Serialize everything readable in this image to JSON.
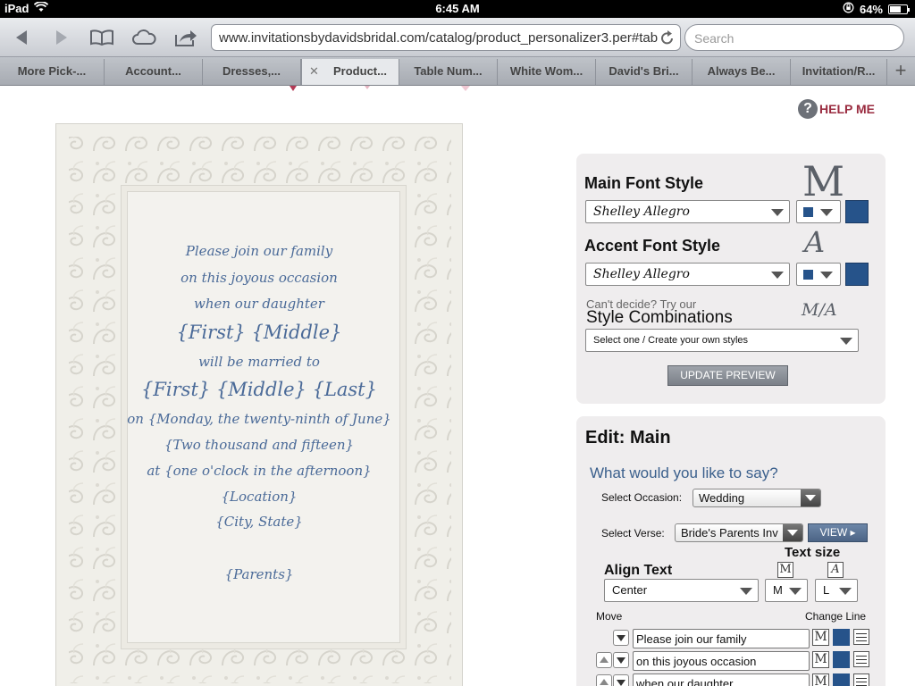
{
  "status_bar": {
    "device": "iPad",
    "time": "6:45 AM",
    "battery": "64%",
    "battery_level": 0.64
  },
  "toolbar": {
    "url": "www.invitationsbydavidsbridal.com/catalog/product_personalizer3.per#tab",
    "search_placeholder": "Search"
  },
  "tabs": [
    {
      "label": "More Pick-..."
    },
    {
      "label": "Account..."
    },
    {
      "label": "Dresses,..."
    },
    {
      "label": "Product..."
    },
    {
      "label": "Table Num..."
    },
    {
      "label": "White Wom..."
    },
    {
      "label": "David's Bri..."
    },
    {
      "label": "Always Be..."
    },
    {
      "label": "Invitation/R..."
    }
  ],
  "help": {
    "label": "HELP ME"
  },
  "invitation": {
    "lines": [
      "Please join our family",
      "on this joyous occasion",
      "when our daughter",
      "{First} {Middle}",
      "will be married to",
      "{First} {Middle} {Last}",
      "on {Monday, the twenty-ninth of June}",
      "{Two thousand and fifteen}",
      "at {one o'clock in the afternoon}",
      "{Location}",
      "{City, State}",
      "{Parents}"
    ]
  },
  "font_panel": {
    "main_title": "Main Font Style",
    "main_font": "Shelley Allegro",
    "main_glyph": "M",
    "accent_title": "Accent Font Style",
    "accent_font": "Shelley Allegro",
    "accent_glyph": "A",
    "cant_decide": "Can't decide? Try our",
    "style_combinations": "Style Combinations",
    "combo_glyph": "M/A",
    "combo_select": "Select one / Create your own styles",
    "update_button": "UPDATE PREVIEW",
    "color": "#26538a"
  },
  "edit_panel": {
    "title": "Edit: Main",
    "question": "What would you like to say?",
    "occasion_label": "Select Occasion:",
    "occasion_value": "Wedding",
    "verse_label": "Select Verse:",
    "verse_value": "Bride's Parents Inv",
    "view_button": "VIEW",
    "text_size_label": "Text size",
    "align_label": "Align Text",
    "align_value": "Center",
    "size_main_glyph": "M",
    "size_accent_glyph": "A",
    "size_main_value": "M",
    "size_accent_value": "L",
    "move_label": "Move",
    "change_line_label": "Change Line",
    "lines": [
      "Please join our family",
      "on this joyous occasion",
      "when our daughter"
    ]
  }
}
